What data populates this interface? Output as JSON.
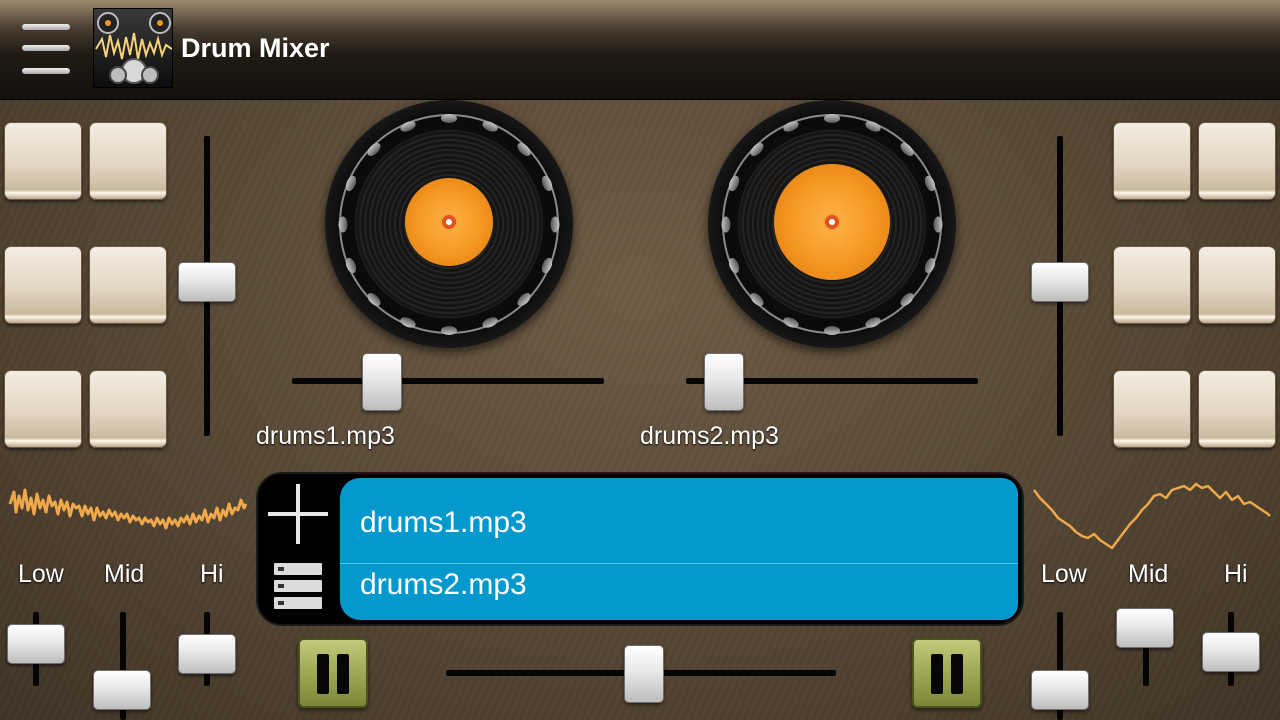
{
  "header": {
    "title": "Drum Mixer",
    "menu_icon": "hamburger-menu-icon",
    "app_icon": "drum-kit-app-icon"
  },
  "deck_left": {
    "file_name": "drums1.mp3",
    "volume_level": 0.5,
    "pitch_level": 0.3
  },
  "deck_right": {
    "file_name": "drums2.mp3",
    "volume_level": 0.5,
    "pitch_level": 0.13
  },
  "eq_left": {
    "labels": [
      "Low",
      "Mid",
      "Hi"
    ],
    "levels": [
      0.45,
      0.1,
      0.6
    ]
  },
  "eq_right": {
    "labels": [
      "Low",
      "Mid",
      "Hi"
    ],
    "levels": [
      0.1,
      0.9,
      0.55
    ]
  },
  "playlist": {
    "items": [
      "drums1.mp3",
      "drums2.mp3"
    ],
    "add_icon": "plus-icon",
    "list_icon": "list-icon"
  },
  "crossfader_level": 0.5,
  "colors": {
    "accent_orange": "#f49620",
    "list_blue": "#0399cc",
    "play_green": "#9ba44f",
    "waveform": "#f0a84a"
  }
}
